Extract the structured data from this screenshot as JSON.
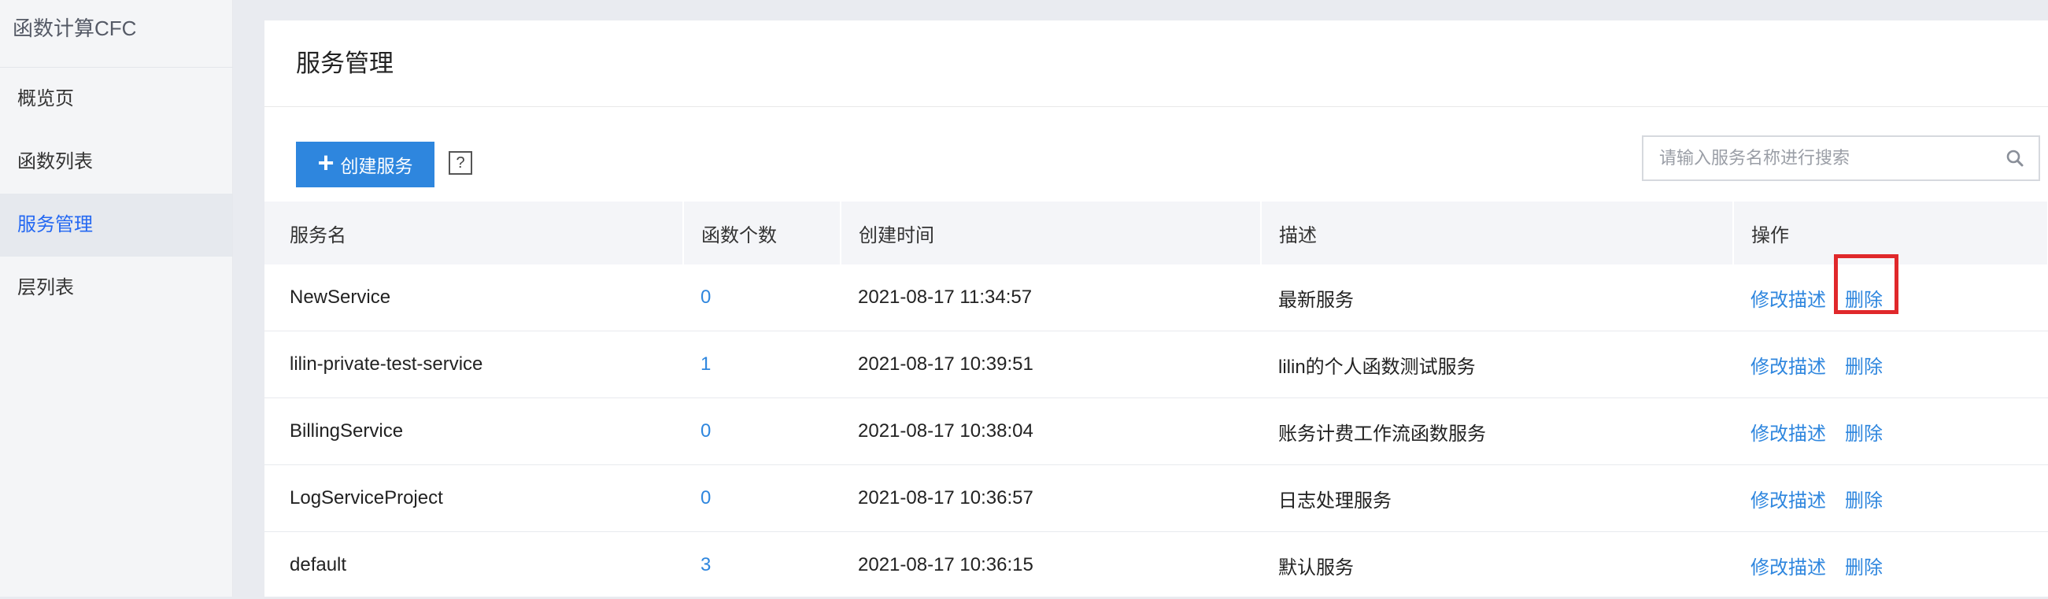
{
  "app": {
    "title": "函数计算CFC"
  },
  "sidebar": {
    "items": [
      {
        "label": "概览页",
        "active": false
      },
      {
        "label": "函数列表",
        "active": false
      },
      {
        "label": "服务管理",
        "active": true
      },
      {
        "label": "层列表",
        "active": false
      }
    ]
  },
  "page": {
    "title": "服务管理",
    "create_button_label": "创建服务",
    "help_label": "?",
    "search": {
      "placeholder": "请输入服务名称进行搜索",
      "value": ""
    }
  },
  "table": {
    "columns": [
      "服务名",
      "函数个数",
      "创建时间",
      "描述",
      "操作"
    ],
    "rows": [
      {
        "name": "NewService",
        "count": "0",
        "created": "2021-08-17 11:34:57",
        "desc": "最新服务",
        "edit": "修改描述",
        "delete": "删除"
      },
      {
        "name": "lilin-private-test-service",
        "count": "1",
        "created": "2021-08-17 10:39:51",
        "desc": "lilin的个人函数测试服务",
        "edit": "修改描述",
        "delete": "删除"
      },
      {
        "name": "BillingService",
        "count": "0",
        "created": "2021-08-17 10:38:04",
        "desc": "账务计费工作流函数服务",
        "edit": "修改描述",
        "delete": "删除"
      },
      {
        "name": "LogServiceProject",
        "count": "0",
        "created": "2021-08-17 10:36:57",
        "desc": "日志处理服务",
        "edit": "修改描述",
        "delete": "删除"
      },
      {
        "name": "default",
        "count": "3",
        "created": "2021-08-17 10:36:15",
        "desc": "默认服务",
        "edit": "修改描述",
        "delete": "删除"
      }
    ]
  },
  "colors": {
    "accent": "#2e86de",
    "active_nav": "#2468f2",
    "highlight": "#e0282b"
  },
  "icons": {
    "create": "plus-icon",
    "help": "help-icon",
    "search": "search-icon"
  }
}
